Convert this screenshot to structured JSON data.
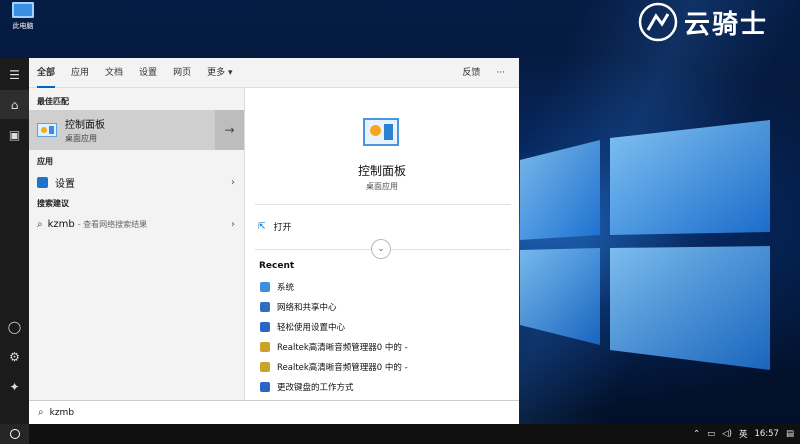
{
  "desktop": {
    "icon_label": "此电脑",
    "brand_text": "云骑士"
  },
  "tabs": [
    {
      "label": "全部"
    },
    {
      "label": "应用"
    },
    {
      "label": "文档"
    },
    {
      "label": "设置"
    },
    {
      "label": "网页"
    },
    {
      "label": "更多 ▾"
    }
  ],
  "tabbar": {
    "feedback": "反馈",
    "more": "···"
  },
  "left": {
    "best_match_header": "最佳匹配",
    "best_match": {
      "title": "控制面板",
      "subtitle": "桌面应用"
    },
    "apps_header": "应用",
    "apps": [
      {
        "label": "设置"
      }
    ],
    "suggestions_header": "搜索建议",
    "suggestions": [
      {
        "query": "kzmb",
        "hint": "- 查看网络搜索结果"
      }
    ]
  },
  "right": {
    "title": "控制面板",
    "subtitle": "桌面应用",
    "open_label": "打开",
    "recent_header": "Recent",
    "recent": [
      {
        "label": "系统",
        "icon": "system-icon",
        "color": "#3b8fe0"
      },
      {
        "label": "网络和共享中心",
        "icon": "network-icon",
        "color": "#2e6fc2"
      },
      {
        "label": "轻松使用设置中心",
        "icon": "ease-of-access-icon",
        "color": "#2a64c6"
      },
      {
        "label": "Realtek高清晰音频管理器0 中的 -",
        "icon": "realtek-icon",
        "color": "#caa22a"
      },
      {
        "label": "Realtek高清晰音频管理器0 中的 -",
        "icon": "realtek-icon",
        "color": "#caa22a"
      },
      {
        "label": "更改键盘的工作方式",
        "icon": "keyboard-icon",
        "color": "#2a64c6"
      }
    ]
  },
  "search": {
    "value": "kzmb"
  },
  "taskbar": {
    "lang": "英",
    "time": "16:57"
  }
}
